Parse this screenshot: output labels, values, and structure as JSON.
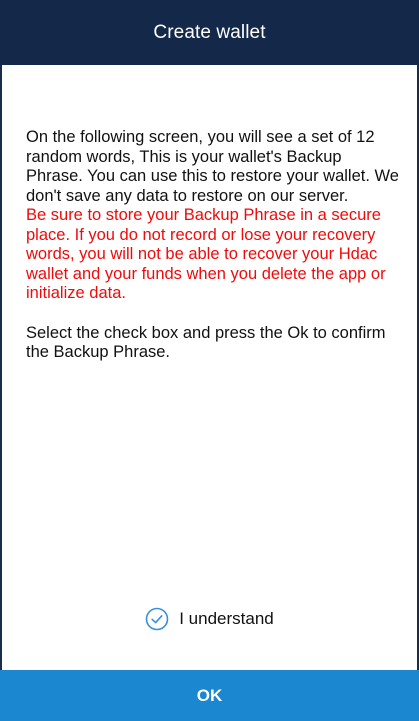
{
  "header": {
    "title": "Create wallet"
  },
  "content": {
    "paragraph1": "On the following screen, you will see a set of 12 random words, This is your wallet's Backup Phrase.  You can use this to restore your wallet. We don't save any data to restore on our server.",
    "warning": "Be sure to store your Backup Phrase in a secure place. If you do not record or lose your recovery words, you will not be able to recover your Hdac wallet and your funds when you delete the app or initialize data.",
    "paragraph2": "Select the check box and press the Ok to confirm the Backup Phrase."
  },
  "checkbox": {
    "label": "I understand",
    "checked": true,
    "icon": "check-circle-icon"
  },
  "footer": {
    "ok_label": "OK"
  },
  "colors": {
    "header_bg": "#14294a",
    "warning_text": "#f00a0a",
    "button_bg": "#1a87d0",
    "check_accent": "#3a8fd8"
  }
}
